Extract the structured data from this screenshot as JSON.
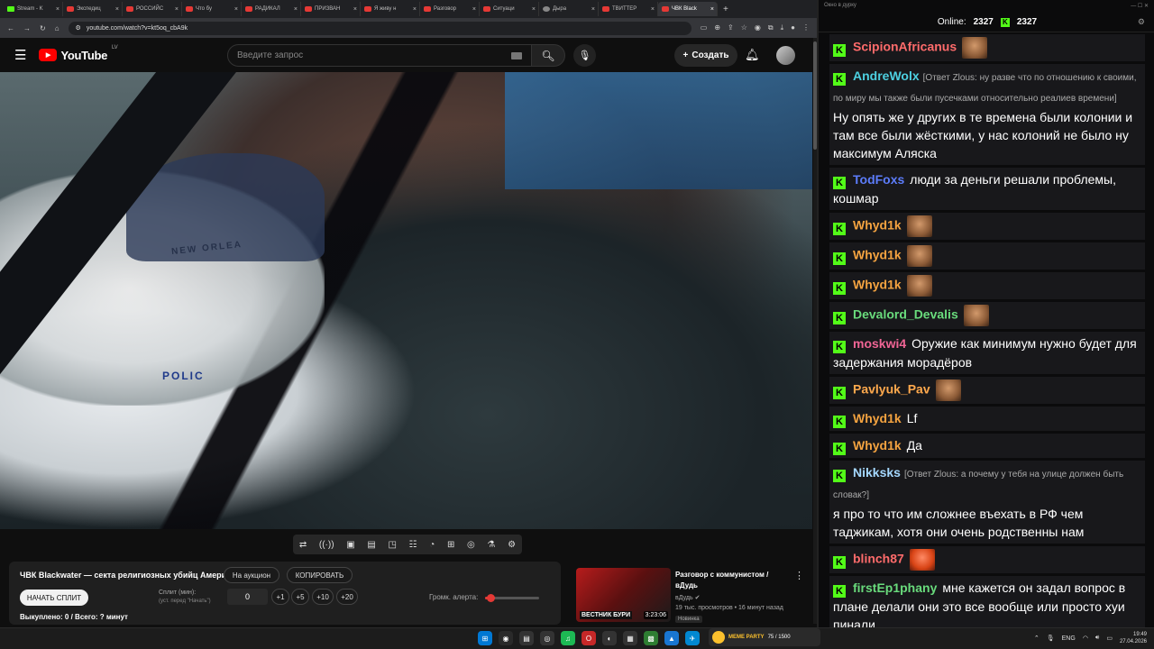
{
  "browser": {
    "tabs": [
      {
        "label": "Stream - K",
        "icon": "kick-favicon"
      },
      {
        "label": "Экспедиц",
        "icon": "youtube-favicon"
      },
      {
        "label": "РОССИЙС",
        "icon": "youtube-favicon"
      },
      {
        "label": "Что бу",
        "icon": "youtube-favicon"
      },
      {
        "label": "РАДИКАЛ",
        "icon": "youtube-favicon"
      },
      {
        "label": "ПРИЗВАН",
        "icon": "youtube-favicon"
      },
      {
        "label": "Я живу н",
        "icon": "youtube-favicon"
      },
      {
        "label": "Разговор",
        "icon": "youtube-favicon"
      },
      {
        "label": "Ситуаци",
        "icon": "youtube-favicon"
      },
      {
        "label": "Дыра",
        "icon": "generic-favicon"
      },
      {
        "label": "ТВИТТЕР",
        "icon": "youtube-favicon"
      },
      {
        "label": "ЧВК Black",
        "icon": "youtube-favicon",
        "active": true
      }
    ],
    "url": "youtube.com/watch?v=kt5oq_cbA9k"
  },
  "youtube": {
    "logo_text": "YouTube",
    "region": "LV",
    "search_placeholder": "Введите запрос",
    "create_label": "Создать"
  },
  "video": {
    "overlay_text_1": "NEW ORLEA",
    "overlay_text_2": "POLIC"
  },
  "panel": {
    "title": "ЧВК Blackwater — секта религиозных убийц Америки!",
    "auction_label": "На аукцион",
    "copy_label": "КОПИРОВАТЬ",
    "start_split_label": "НАЧАТЬ СПЛИТ",
    "split_label": "Сплит (мин):",
    "split_hint": "(уст. перед \"Начать\")",
    "split_value": "0",
    "increments": [
      "+1",
      "+5",
      "+10",
      "+20"
    ],
    "alert_volume_label": "Громк. алерта:",
    "alert_volume_level": 0.1,
    "bought": "Выкуплено: 0 / Всего: ? минут"
  },
  "recommendation": {
    "title": "Разговор с коммунистом / вДудь",
    "channel": "вДудь",
    "views": "19 тыс. просмотров • 16 минут назад",
    "badge": "Новинка",
    "duration": "3:23:06",
    "thumb_caption": "ВЕСТНИК БУРИ"
  },
  "chat": {
    "window_title": "Окно в дурку",
    "online_label": "Online:",
    "online_count": "2327",
    "kick_count": "2327",
    "messages": [
      {
        "nick": "ScipionAfricanus",
        "color": "#ff6b6b",
        "reply": "",
        "text": "",
        "emote": true
      },
      {
        "nick": "AndreWolx",
        "color": "#4dd0e1",
        "reply": "[Ответ Zlous: ну разве что по отношению к своими, по миру мы также были пусечками относительно реалиев времени]",
        "text": "Ну опять же у других в те времена были колонии и там все были жёсткими, у нас колоний не было ну максимум Аляска",
        "emote": false
      },
      {
        "nick": "TodFoxs",
        "color": "#5c7cfa",
        "reply": "",
        "text": "люди за деньги решали проблемы, кошмар",
        "emote": false
      },
      {
        "nick": "Whyd1k",
        "color": "#f4a340",
        "reply": "",
        "text": "",
        "emote": true
      },
      {
        "nick": "Whyd1k",
        "color": "#f4a340",
        "reply": "",
        "text": "",
        "emote": true
      },
      {
        "nick": "Whyd1k",
        "color": "#f4a340",
        "reply": "",
        "text": "",
        "emote": true
      },
      {
        "nick": "Devalord_Devalis",
        "color": "#69db7c",
        "reply": "",
        "text": "",
        "emote": true
      },
      {
        "nick": "moskwi4",
        "color": "#f06595",
        "reply": "",
        "text": "Оружие как минимум нужно будет для задержания морадёров",
        "emote": false
      },
      {
        "nick": "Pavlyuk_Pav",
        "color": "#ffa94d",
        "reply": "",
        "text": "",
        "emote": true
      },
      {
        "nick": "Whyd1k",
        "color": "#f4a340",
        "reply": "",
        "text": "Lf",
        "emote": false
      },
      {
        "nick": "Whyd1k",
        "color": "#f4a340",
        "reply": "",
        "text": "Да",
        "emote": false
      },
      {
        "nick": "Nikksks",
        "color": "#a5d8ff",
        "reply": "[Ответ Zlous: а почему у тебя на улице должен быть словак?]",
        "text": "я про то что им сложнее въехать в РФ чем таджикам, хотя они очень родственны нам",
        "emote": false
      },
      {
        "nick": "blinch87",
        "color": "#ff6b6b",
        "reply": "",
        "text": "",
        "emote": true,
        "emote_style": "red"
      },
      {
        "nick": "firstEp1phany",
        "color": "#69db7c",
        "reply": "",
        "text": "мне кажется он задал вопрос в плане делали они это все вообще или просто хуи пинали",
        "emote": false
      }
    ]
  },
  "taskbar": {
    "meme_title": "MEME PARTY",
    "meme_counter": "75 / 1500",
    "lang": "ENG",
    "time": "19:49",
    "date": "27.04.2026"
  }
}
